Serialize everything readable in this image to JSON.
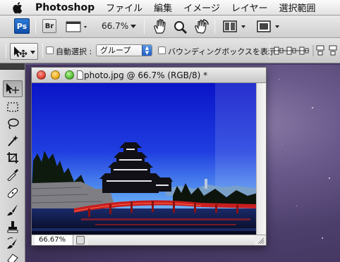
{
  "menubar": {
    "app_name": "Photoshop",
    "items": [
      "ファイル",
      "編集",
      "イメージ",
      "レイヤー",
      "選択範囲"
    ]
  },
  "options_top": {
    "ps_label": "Ps",
    "br_label": "Br",
    "zoom_value": "66.7%"
  },
  "options_move": {
    "auto_select_label": "自動選択 :",
    "auto_select_checked": false,
    "auto_select_target": "グループ",
    "show_bounding_label": "バウンディングボックスを表示",
    "show_bounding_checked": false
  },
  "document": {
    "title": "photo.jpg @ 66.7% (RGB/8) *",
    "zoom_status": "66.67%"
  },
  "colors": {
    "sky_top": "#0a14c8",
    "sky_bottom": "#9fd4ff",
    "bridge": "#c81e1e",
    "close_light": "#e0443a",
    "minimize_light": "#f0b020",
    "zoom_light": "#58c03a"
  },
  "icons": [
    "apple-logo",
    "document-icon",
    "hand-icon",
    "zoom-icon",
    "rotate-view-icon",
    "arrange-documents-icon",
    "screen-mode-icon",
    "move-tool-icon"
  ]
}
